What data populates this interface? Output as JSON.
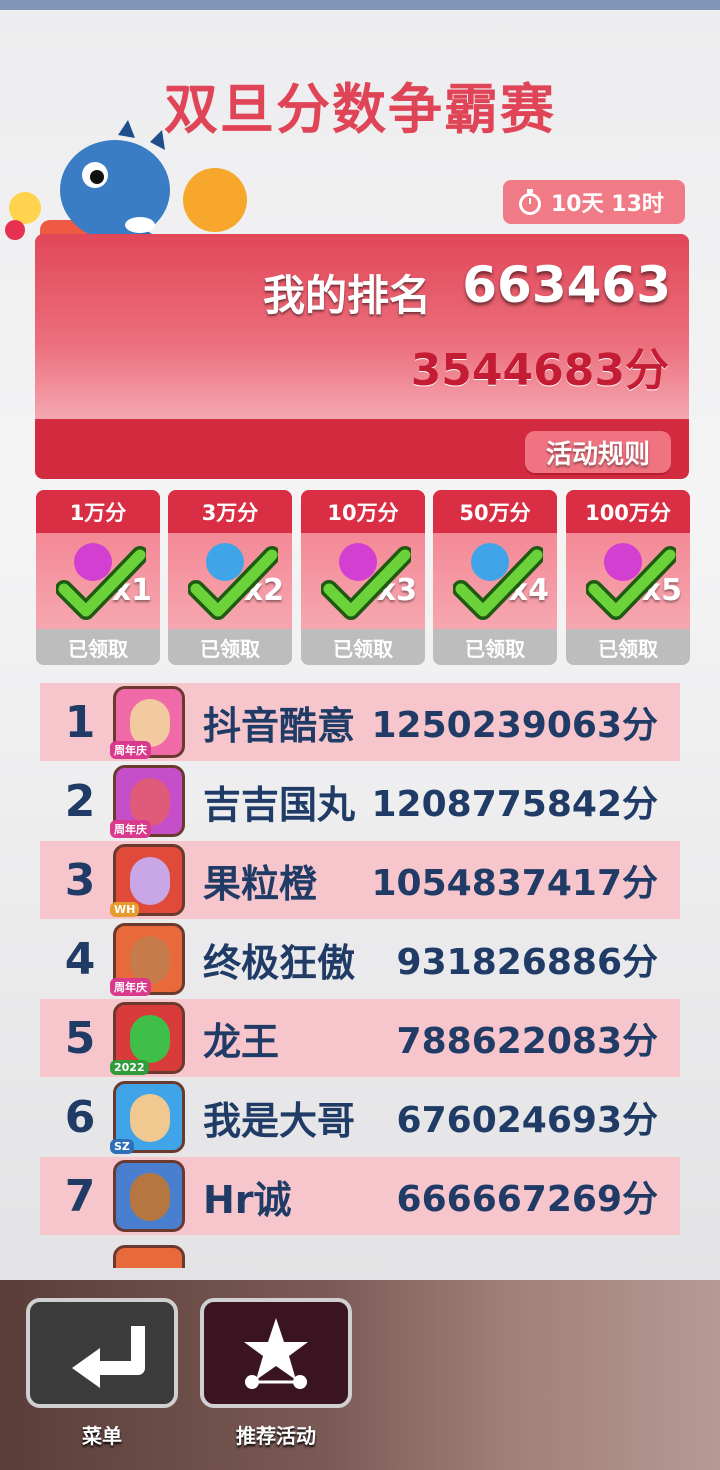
{
  "event": {
    "title": "双旦分数争霸赛",
    "timer": "10天 13时"
  },
  "my_rank": {
    "label": "我的排名",
    "rank": "663463",
    "score": "3544683分",
    "rules_button": "活动规则"
  },
  "milestones": [
    {
      "threshold": "1万分",
      "count": "x1",
      "status": "已领取"
    },
    {
      "threshold": "3万分",
      "count": "x2",
      "status": "已领取"
    },
    {
      "threshold": "10万分",
      "count": "x3",
      "status": "已领取"
    },
    {
      "threshold": "50万分",
      "count": "x4",
      "status": "已领取"
    },
    {
      "threshold": "100万分",
      "count": "x5",
      "status": "已领取"
    }
  ],
  "leaderboard": [
    {
      "rank": "1",
      "name": "抖音酷意",
      "score": "1250239063分",
      "badge": "周年庆"
    },
    {
      "rank": "2",
      "name": "吉吉国丸",
      "score": "1208775842分",
      "badge": "周年庆"
    },
    {
      "rank": "3",
      "name": "果粒橙",
      "score": "1054837417分",
      "badge": "WH"
    },
    {
      "rank": "4",
      "name": "终极狂傲",
      "score": "931826886分",
      "badge": "周年庆"
    },
    {
      "rank": "5",
      "name": "龙王",
      "score": "788622083分",
      "badge": "2022"
    },
    {
      "rank": "6",
      "name": "我是大哥",
      "score": "676024693分",
      "badge": "SZ"
    },
    {
      "rank": "7",
      "name": "Hr诚",
      "score": "666667269分",
      "badge": ""
    }
  ],
  "nav": {
    "menu_label": "菜单",
    "recommend_label": "推荐活动"
  },
  "colors": {
    "title": "#e04457",
    "card_red": "#d22a3f",
    "row_pink": "#f6c6cc",
    "text_navy": "#1f3b66",
    "claimed_gray": "#bdbdbd"
  },
  "icons": {
    "timer": "stopwatch-icon",
    "claimed": "check-icon",
    "menu": "return-arrow-icon",
    "recommend": "star-icon"
  }
}
